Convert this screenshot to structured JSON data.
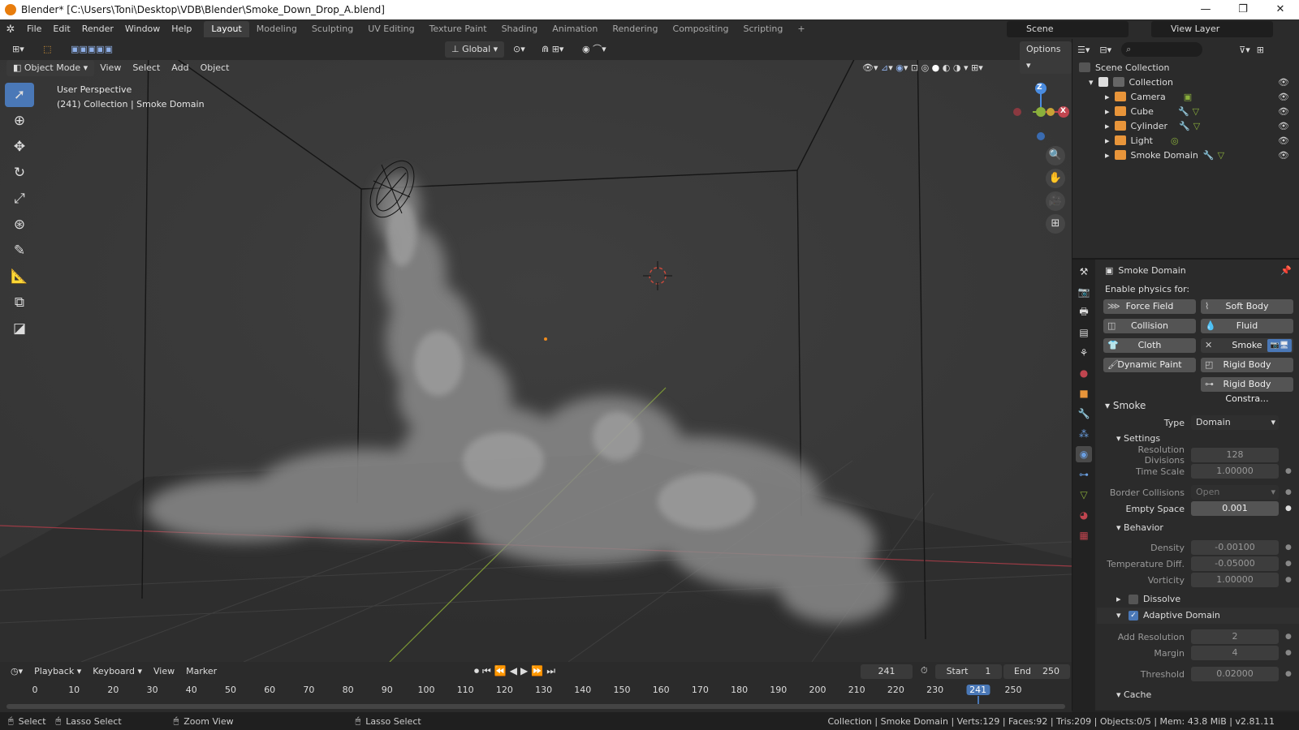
{
  "window": {
    "title": "Blender* [C:\\Users\\Toni\\Desktop\\VDB\\Blender\\Smoke_Down_Drop_A.blend]",
    "minimize": "—",
    "maximize": "❐",
    "close": "✕"
  },
  "menu": [
    "File",
    "Edit",
    "Render",
    "Window",
    "Help"
  ],
  "workspaces": [
    "Layout",
    "Modeling",
    "Sculpting",
    "UV Editing",
    "Texture Paint",
    "Shading",
    "Animation",
    "Rendering",
    "Compositing",
    "Scripting",
    "+"
  ],
  "scene": "Scene",
  "view_layer": "View Layer",
  "header": {
    "transform_orientation": "Global",
    "options": "Options"
  },
  "viewport_header": {
    "mode": "Object Mode",
    "items": [
      "View",
      "Select",
      "Add",
      "Object"
    ]
  },
  "viewport": {
    "perspective": "User Perspective",
    "context": "(241) Collection | Smoke Domain",
    "gizmo": {
      "z": "Z",
      "x": "X"
    }
  },
  "outliner": {
    "root": "Scene Collection",
    "collection": "Collection",
    "items": [
      {
        "name": "Camera",
        "color": "#e8953a"
      },
      {
        "name": "Cube",
        "color": "#e8953a"
      },
      {
        "name": "Cylinder",
        "color": "#e8953a"
      },
      {
        "name": "Light",
        "color": "#e8953a"
      },
      {
        "name": "Smoke Domain",
        "color": "#e8953a"
      }
    ],
    "eye": "👁"
  },
  "properties": {
    "object": "Smoke Domain",
    "enable_label": "Enable physics for:",
    "buttons": [
      [
        "Force Field",
        "Soft Body"
      ],
      [
        "Collision",
        "Fluid"
      ],
      [
        "Cloth",
        "Smoke"
      ],
      [
        "Dynamic Paint",
        "Rigid Body"
      ]
    ],
    "rigid_constraint": "Rigid Body Constra...",
    "smoke_section": "Smoke",
    "type_label": "Type",
    "type_value": "Domain",
    "settings": "Settings",
    "resolution_label": "Resolution Divisions",
    "resolution_value": "128",
    "time_scale_label": "Time Scale",
    "time_scale_value": "1.00000",
    "border_label": "Border Collisions",
    "border_value": "Open",
    "empty_label": "Empty Space",
    "empty_value": "0.001",
    "behavior": "Behavior",
    "density_label": "Density",
    "density_value": "-0.00100",
    "temp_label": "Temperature Diff.",
    "temp_value": "-0.05000",
    "vorticity_label": "Vorticity",
    "vorticity_value": "1.00000",
    "dissolve": "Dissolve",
    "adaptive": "Adaptive Domain",
    "add_res_label": "Add Resolution",
    "add_res_value": "2",
    "margin_label": "Margin",
    "margin_value": "4",
    "threshold_label": "Threshold",
    "threshold_value": "0.02000",
    "cache": "Cache"
  },
  "timeline": {
    "menu": [
      "Playback",
      "Keyboard",
      "View",
      "Marker"
    ],
    "current_frame": "241",
    "start_label": "Start",
    "start": "1",
    "end_label": "End",
    "end": "250",
    "ticks": [
      "0",
      "10",
      "20",
      "30",
      "40",
      "50",
      "60",
      "70",
      "80",
      "90",
      "100",
      "110",
      "120",
      "130",
      "140",
      "150",
      "160",
      "170",
      "180",
      "190",
      "200",
      "210",
      "220",
      "230",
      "241",
      "250"
    ]
  },
  "status": {
    "select": "Select",
    "lasso1": "Lasso Select",
    "zoom": "Zoom View",
    "lasso2": "Lasso Select",
    "stats": "Collection | Smoke Domain | Verts:129 | Faces:92 | Tris:209 | Objects:0/5 | Mem: 43.8 MiB | v2.81.11"
  },
  "colors": {
    "accent": "#4a78b7",
    "active_frame": "#4a78b7",
    "x_axis": "#c0454f",
    "y_axis": "#8bb03c",
    "z_axis": "#4a8ce0"
  }
}
